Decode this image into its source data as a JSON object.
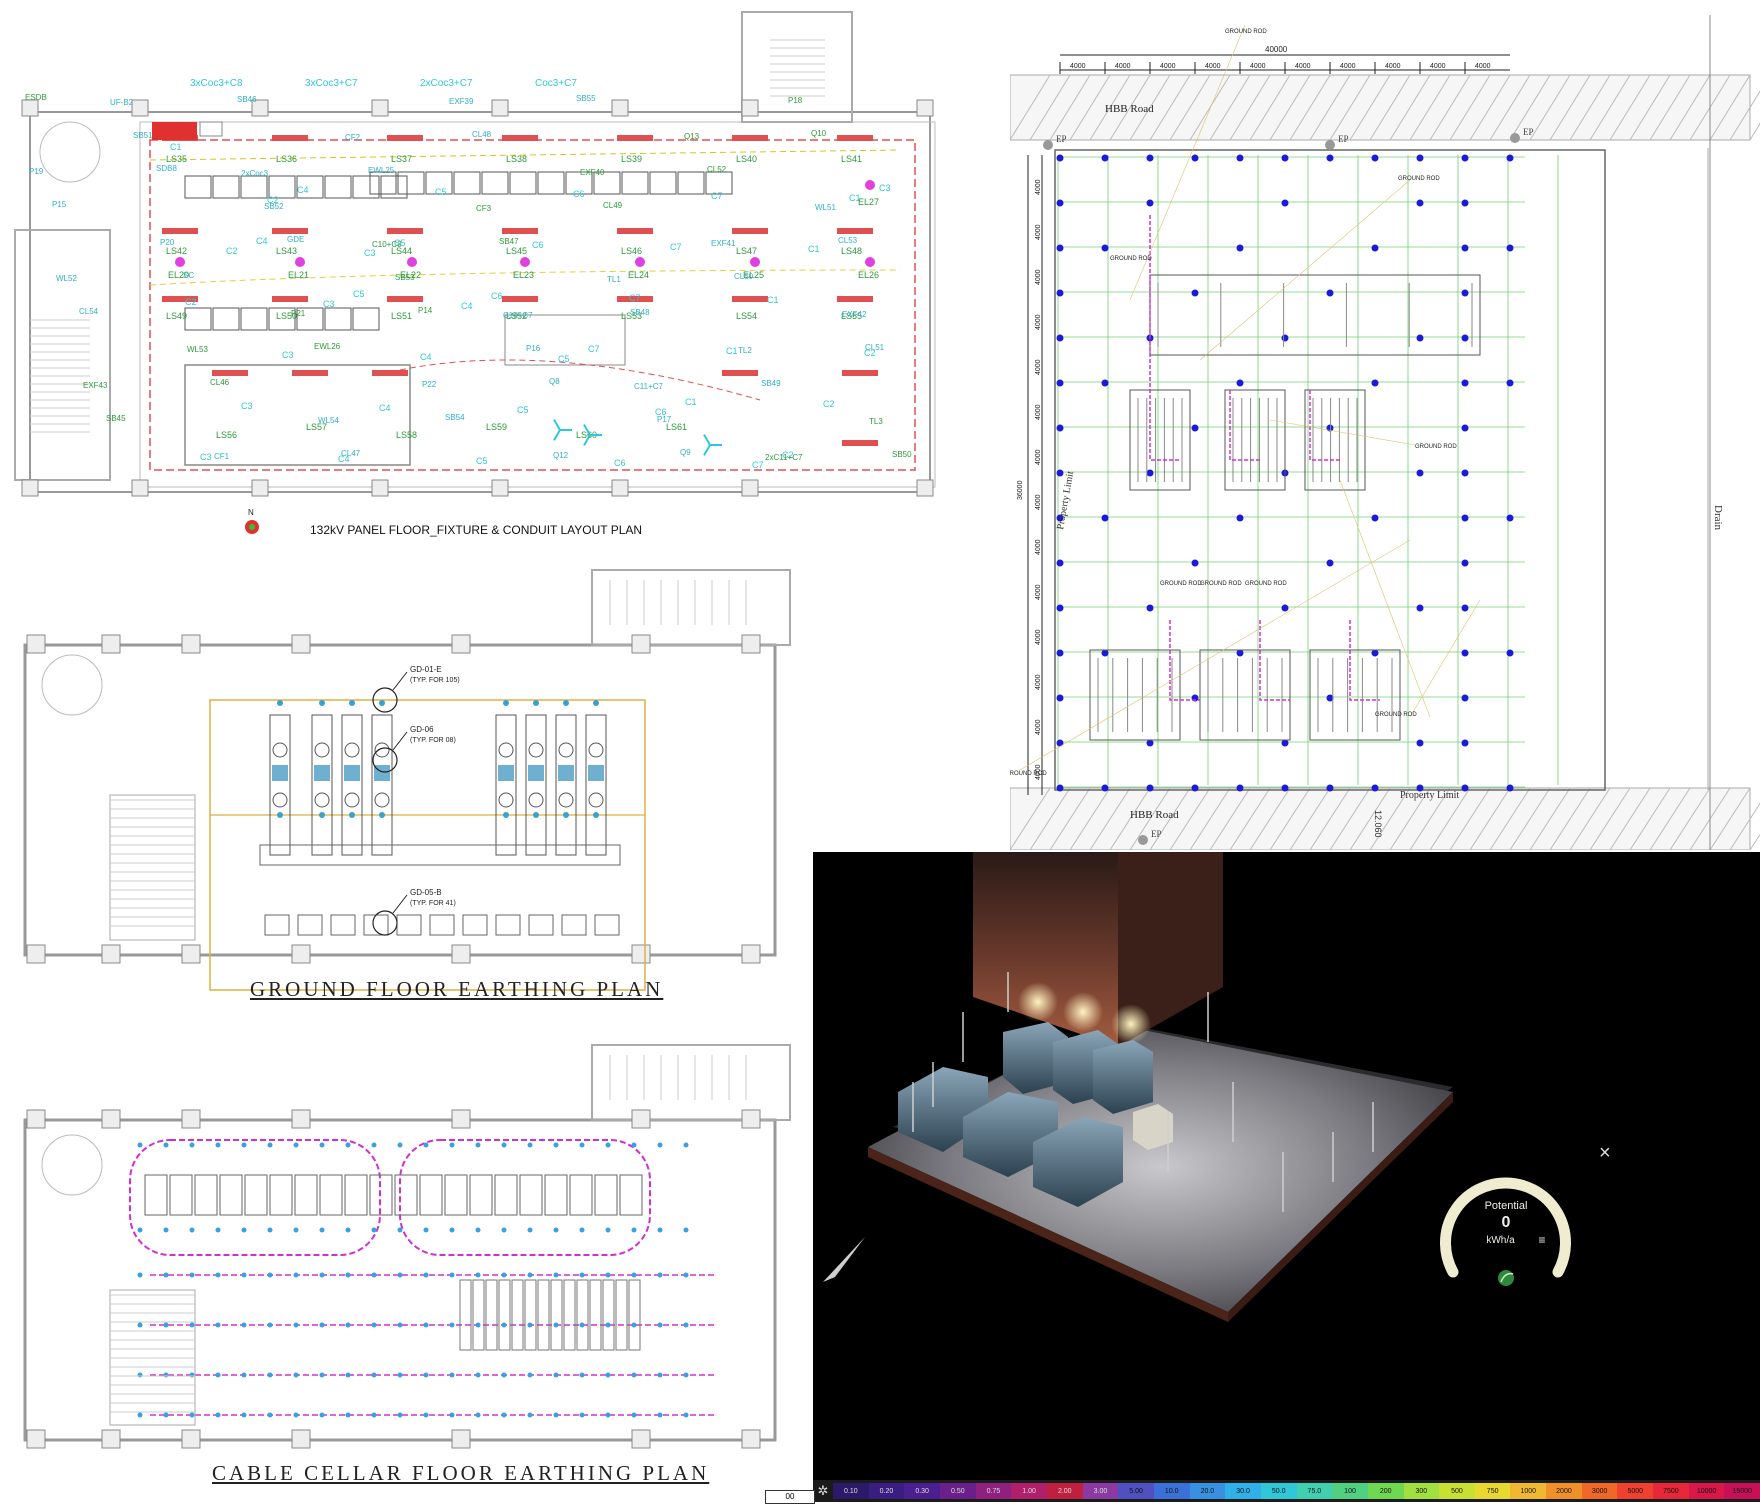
{
  "panels": {
    "fixture_plan": {
      "title": "132kV PANEL FLOOR_FIXTURE & CONDUIT LAYOUT PLAN",
      "compass_label": "N",
      "labels_top": [
        "3xCoc3+C8",
        "3xCoc3+C7",
        "2xCoc3+C7",
        "Coc3+C7"
      ],
      "fixture_tags": [
        "LS35",
        "LS36",
        "LS37",
        "LS38",
        "LS39",
        "LS40",
        "LS41",
        "LS42",
        "LS43",
        "LS44",
        "LS45",
        "LS46",
        "LS47",
        "LS48",
        "LS49",
        "LS50",
        "LS51",
        "LS52",
        "LS53",
        "LS54",
        "LS55",
        "LS56",
        "LS57",
        "LS58",
        "LS59",
        "LS60",
        "LS61"
      ],
      "emergency_tags": [
        "EL20",
        "EL21",
        "EL22",
        "EL23",
        "EL24",
        "EL25",
        "EL26",
        "EL27"
      ],
      "other_tags": [
        "ESDB",
        "SDB8",
        "GDE",
        "P14",
        "Q8",
        "Q9",
        "Q10",
        "P15",
        "SC",
        "EWL26",
        "SB54",
        "SB55",
        "CL52",
        "CL53",
        "CL54",
        "CL46",
        "CL47",
        "CL48",
        "CL49",
        "CL50",
        "CL51",
        "SB45",
        "SB46",
        "EWL25",
        "SB47",
        "SB48",
        "SB49",
        "SB50",
        "SB51",
        "SB52",
        "SB53",
        "P16",
        "P17",
        "P18",
        "P19",
        "P20",
        "P21",
        "P22",
        "Q12",
        "Q13",
        "WL51",
        "WL52",
        "WL53",
        "WL54",
        "EXF39",
        "EXF40",
        "EXF41",
        "EXF42",
        "EXF43",
        "CF1",
        "CF2",
        "CF3",
        "TL1",
        "TL2",
        "TL3",
        "UF-B2",
        "2xCoc3",
        "C10+C8",
        "C10+C7",
        "C11+C7",
        "2xC11+C7"
      ]
    },
    "site_plan": {
      "dimension_total": "40000",
      "dimension_segments": [
        "4000",
        "4000",
        "4000",
        "4000",
        "4000",
        "4000",
        "4000",
        "4000",
        "4000",
        "4000"
      ],
      "vertical_total": "36000",
      "vertical_segments": [
        "4000",
        "4000",
        "4000",
        "4000",
        "4000",
        "4000",
        "4000",
        "4000",
        "4000",
        "4000",
        "4000",
        "4000",
        "4000",
        "4000"
      ],
      "road_top": "HBB Road",
      "road_bottom": "HBB Road",
      "drain": "Drain",
      "property_limit_left": "Property Limit",
      "property_limit_bottom": "Property Limit",
      "ground_rod": "GROUND ROD",
      "ep": "EP",
      "vertical_bottom_dim": "12.060"
    },
    "ground_floor": {
      "title": "GROUND FLOOR EARTHING PLAN",
      "callout_1_id": "GD-01-E",
      "callout_1_note": "(TYP. FOR 105)",
      "callout_2_id": "GD-06",
      "callout_2_note": "(TYP. FOR 08)",
      "callout_3_id": "GD-05-B",
      "callout_3_note": "(TYP. FOR 41)"
    },
    "cable_cellar": {
      "title": "CABLE CELLAR FLOOR EARTHING PLAN"
    },
    "render_3d": {
      "gauge_label": "Potential",
      "gauge_value": "0",
      "gauge_unit": "kWh/a",
      "close_symbol": "×",
      "menu_symbol": "≡",
      "gear_symbol": "✲",
      "legend_values": [
        "0.10",
        "0.20",
        "0.30",
        "0.50",
        "0.75",
        "1.00",
        "2.00",
        "3.00",
        "5.00",
        "10.0",
        "20.0",
        "30.0",
        "50.0",
        "75.0",
        "100",
        "200",
        "300",
        "500",
        "750",
        "1000",
        "2000",
        "3000",
        "5000",
        "7500",
        "10000",
        "15000"
      ],
      "legend_colors": [
        "#2b1a6a",
        "#3a1d80",
        "#4a2090",
        "#6a1f8a",
        "#902080",
        "#b01f6a",
        "#c02040",
        "#8a3aa0",
        "#5050c0",
        "#3a70d8",
        "#3a90e0",
        "#30b0e8",
        "#30c8d8",
        "#40d0b0",
        "#50d080",
        "#70d850",
        "#a0e040",
        "#c8e030",
        "#e8d830",
        "#f0b830",
        "#f09028",
        "#f06828",
        "#f04030",
        "#e82838",
        "#d81848",
        "#c81058"
      ]
    }
  },
  "page_number": "00"
}
